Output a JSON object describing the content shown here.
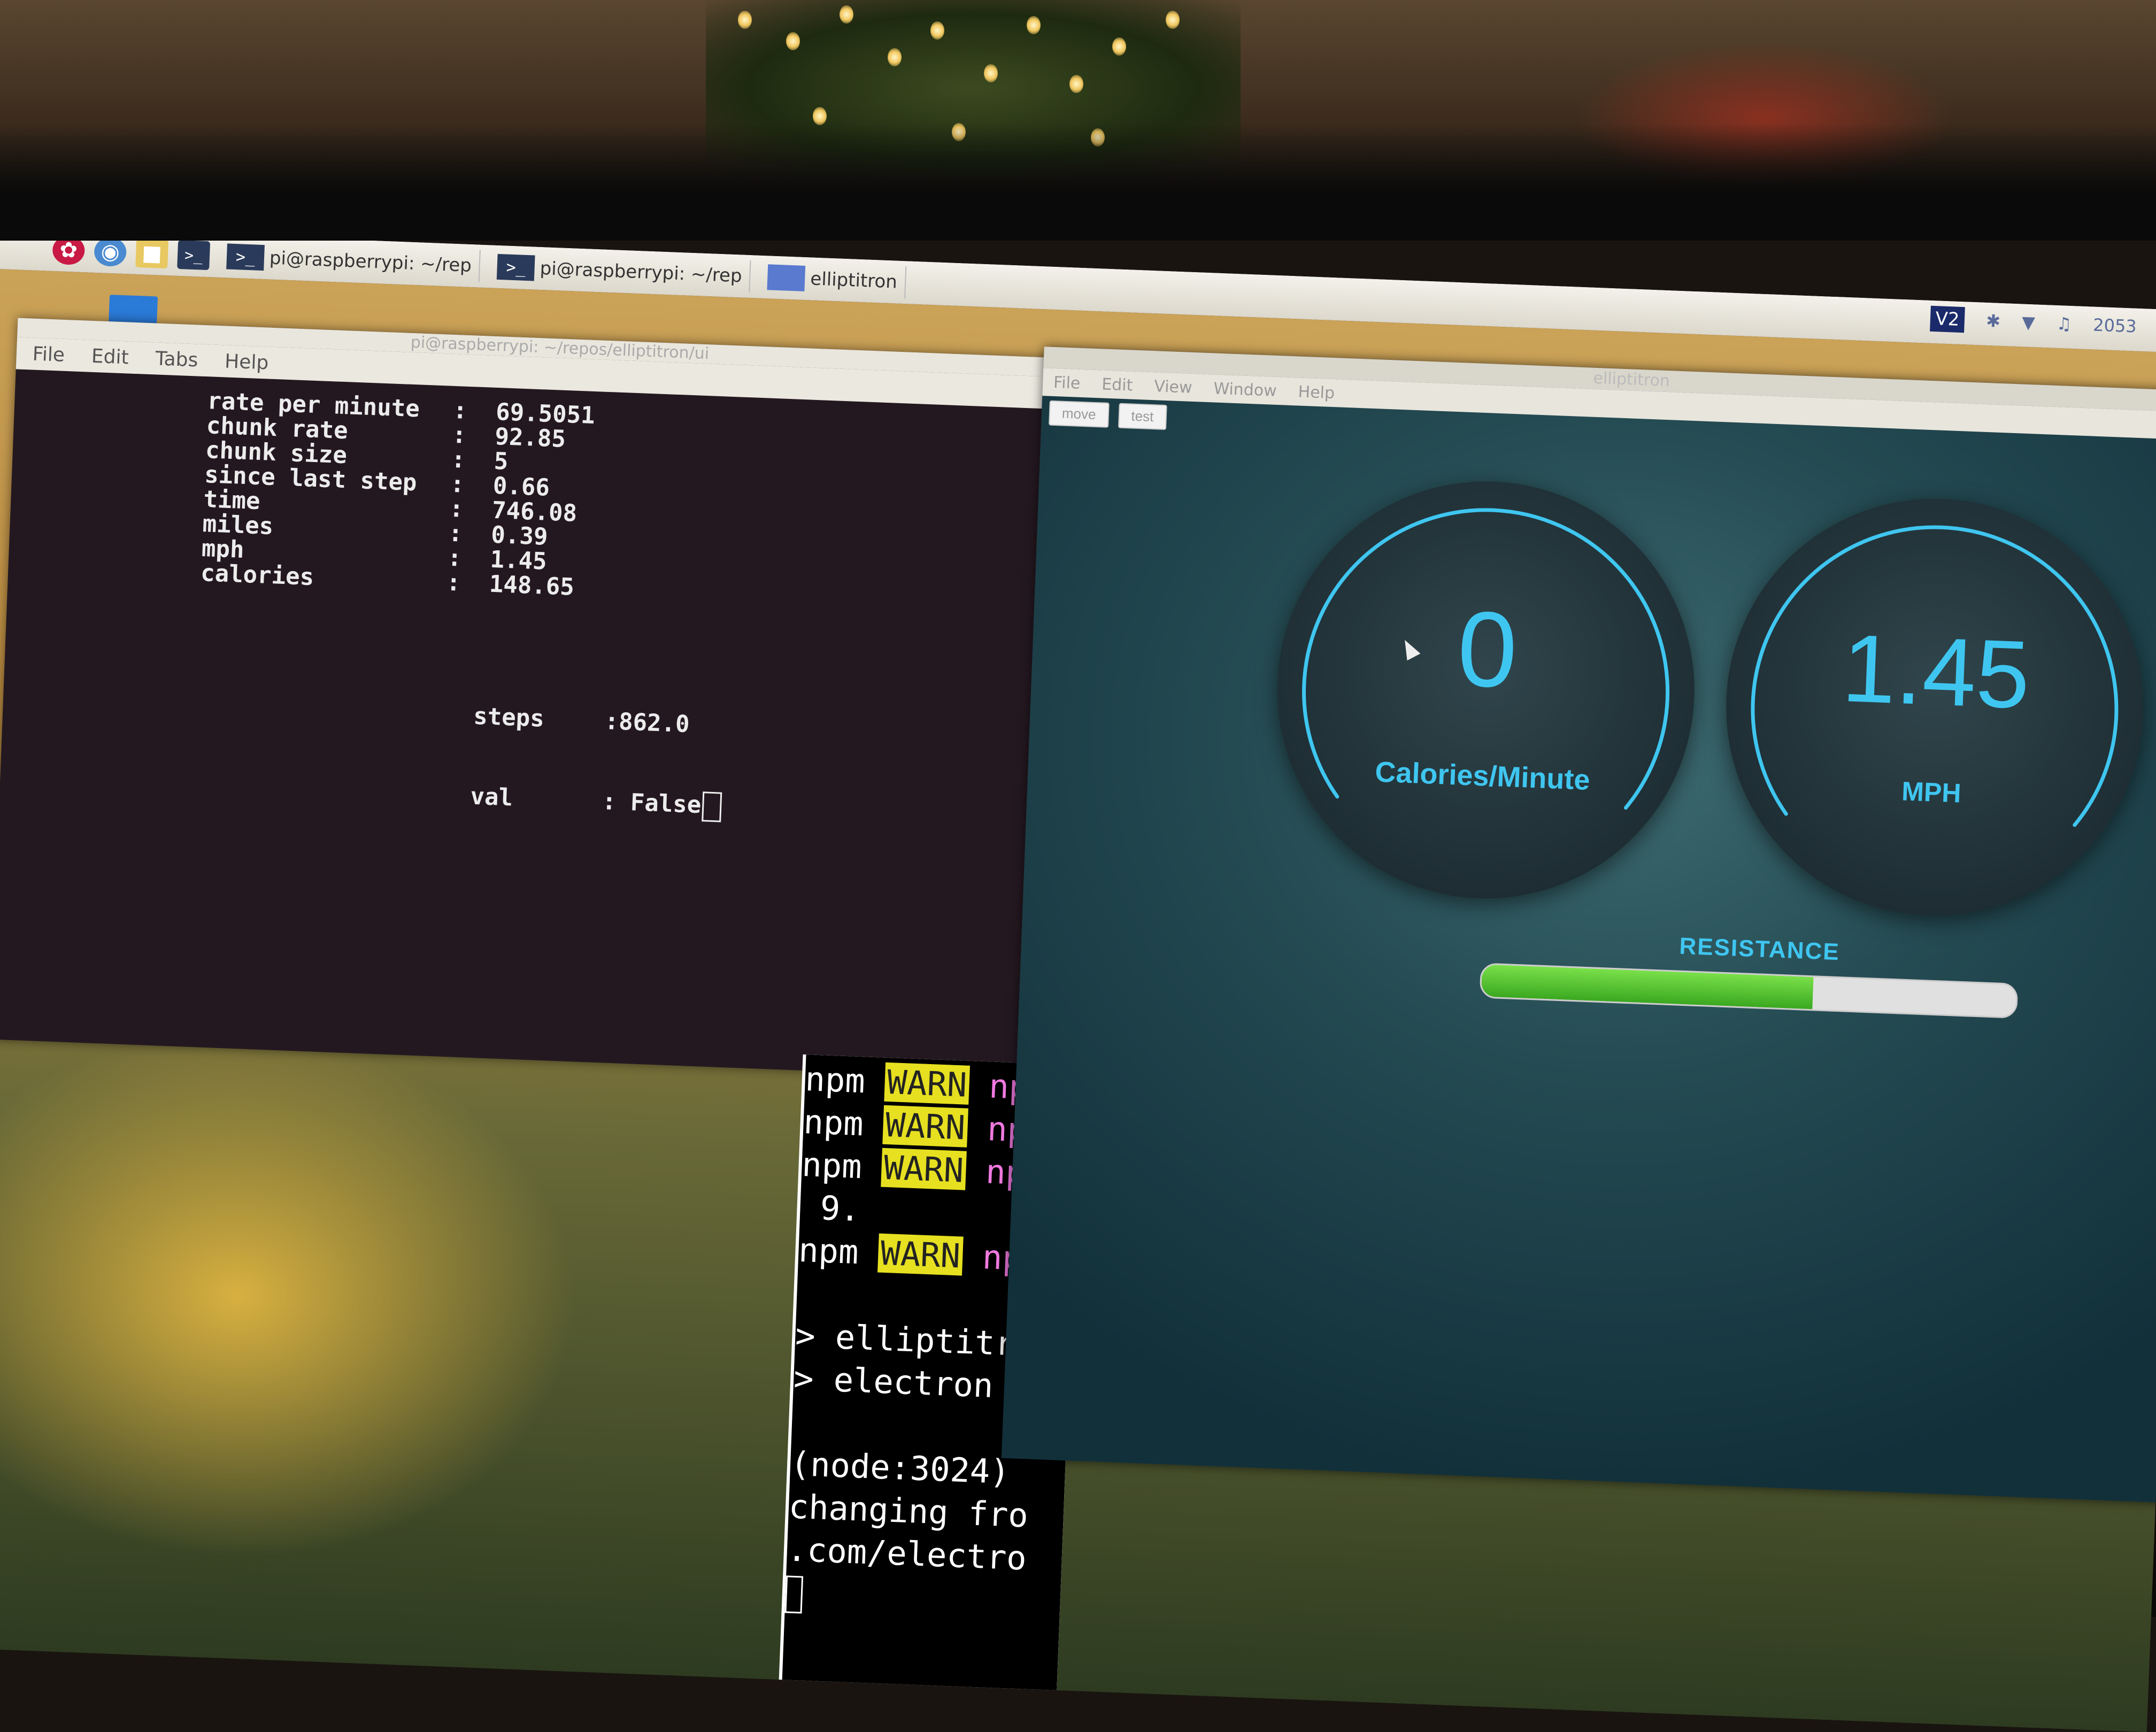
{
  "taskbar": {
    "tasks": [
      {
        "label": "pi@raspberrypi: ~/rep"
      },
      {
        "label": "pi@raspberrypi: ~/rep"
      },
      {
        "label": "elliptitron"
      }
    ],
    "tray": {
      "vnc": "V2",
      "clock": "2053"
    }
  },
  "terminal": {
    "title": "pi@raspberrypi: ~/repos/elliptitron/ui",
    "menu": [
      "File",
      "Edit",
      "Tabs",
      "Help"
    ],
    "stats": [
      {
        "key": "rate per minute",
        "value": "69.5051"
      },
      {
        "key": "chunk rate",
        "value": "92.85"
      },
      {
        "key": "chunk size",
        "value": "5"
      },
      {
        "key": "since last step",
        "value": "0.66"
      },
      {
        "key": "time",
        "value": "746.08"
      },
      {
        "key": "miles",
        "value": "0.39"
      },
      {
        "key": "mph",
        "value": "1.45"
      },
      {
        "key": "calories",
        "value": "148.65"
      }
    ],
    "steps_label": "steps",
    "steps_value": ":862.0",
    "val_label": "val",
    "val_value": ": False"
  },
  "npm_terminal": {
    "lines": [
      {
        "a": "npm",
        "b": "WARN",
        "c": "npm"
      },
      {
        "a": "npm",
        "b": "WARN",
        "c": "npm"
      },
      {
        "a": "npm",
        "b": "WARN",
        "c": "npm"
      },
      {
        "text": " 9."
      },
      {
        "a": "npm",
        "b": "WARN",
        "c": "npm"
      },
      {
        "text": ""
      },
      {
        "text": "> elliptitro"
      },
      {
        "text": "> electron ."
      },
      {
        "text": ""
      },
      {
        "text": "(node:3024)"
      },
      {
        "text": "changing fro"
      },
      {
        "text": ".com/electro"
      }
    ]
  },
  "app": {
    "title": "elliptitron",
    "menu": [
      "File",
      "Edit",
      "View",
      "Window",
      "Help"
    ],
    "buttons": {
      "move": "move",
      "test": "test"
    },
    "gauges": [
      {
        "value": "0",
        "label": "Calories/Minute"
      },
      {
        "value": "1.45",
        "label": "MPH"
      }
    ],
    "resistance": {
      "label": "RESISTANCE",
      "level": 0.62
    },
    "colors": {
      "accent": "#3fc6f0",
      "resistance_fill": "#4cbf2a"
    }
  }
}
